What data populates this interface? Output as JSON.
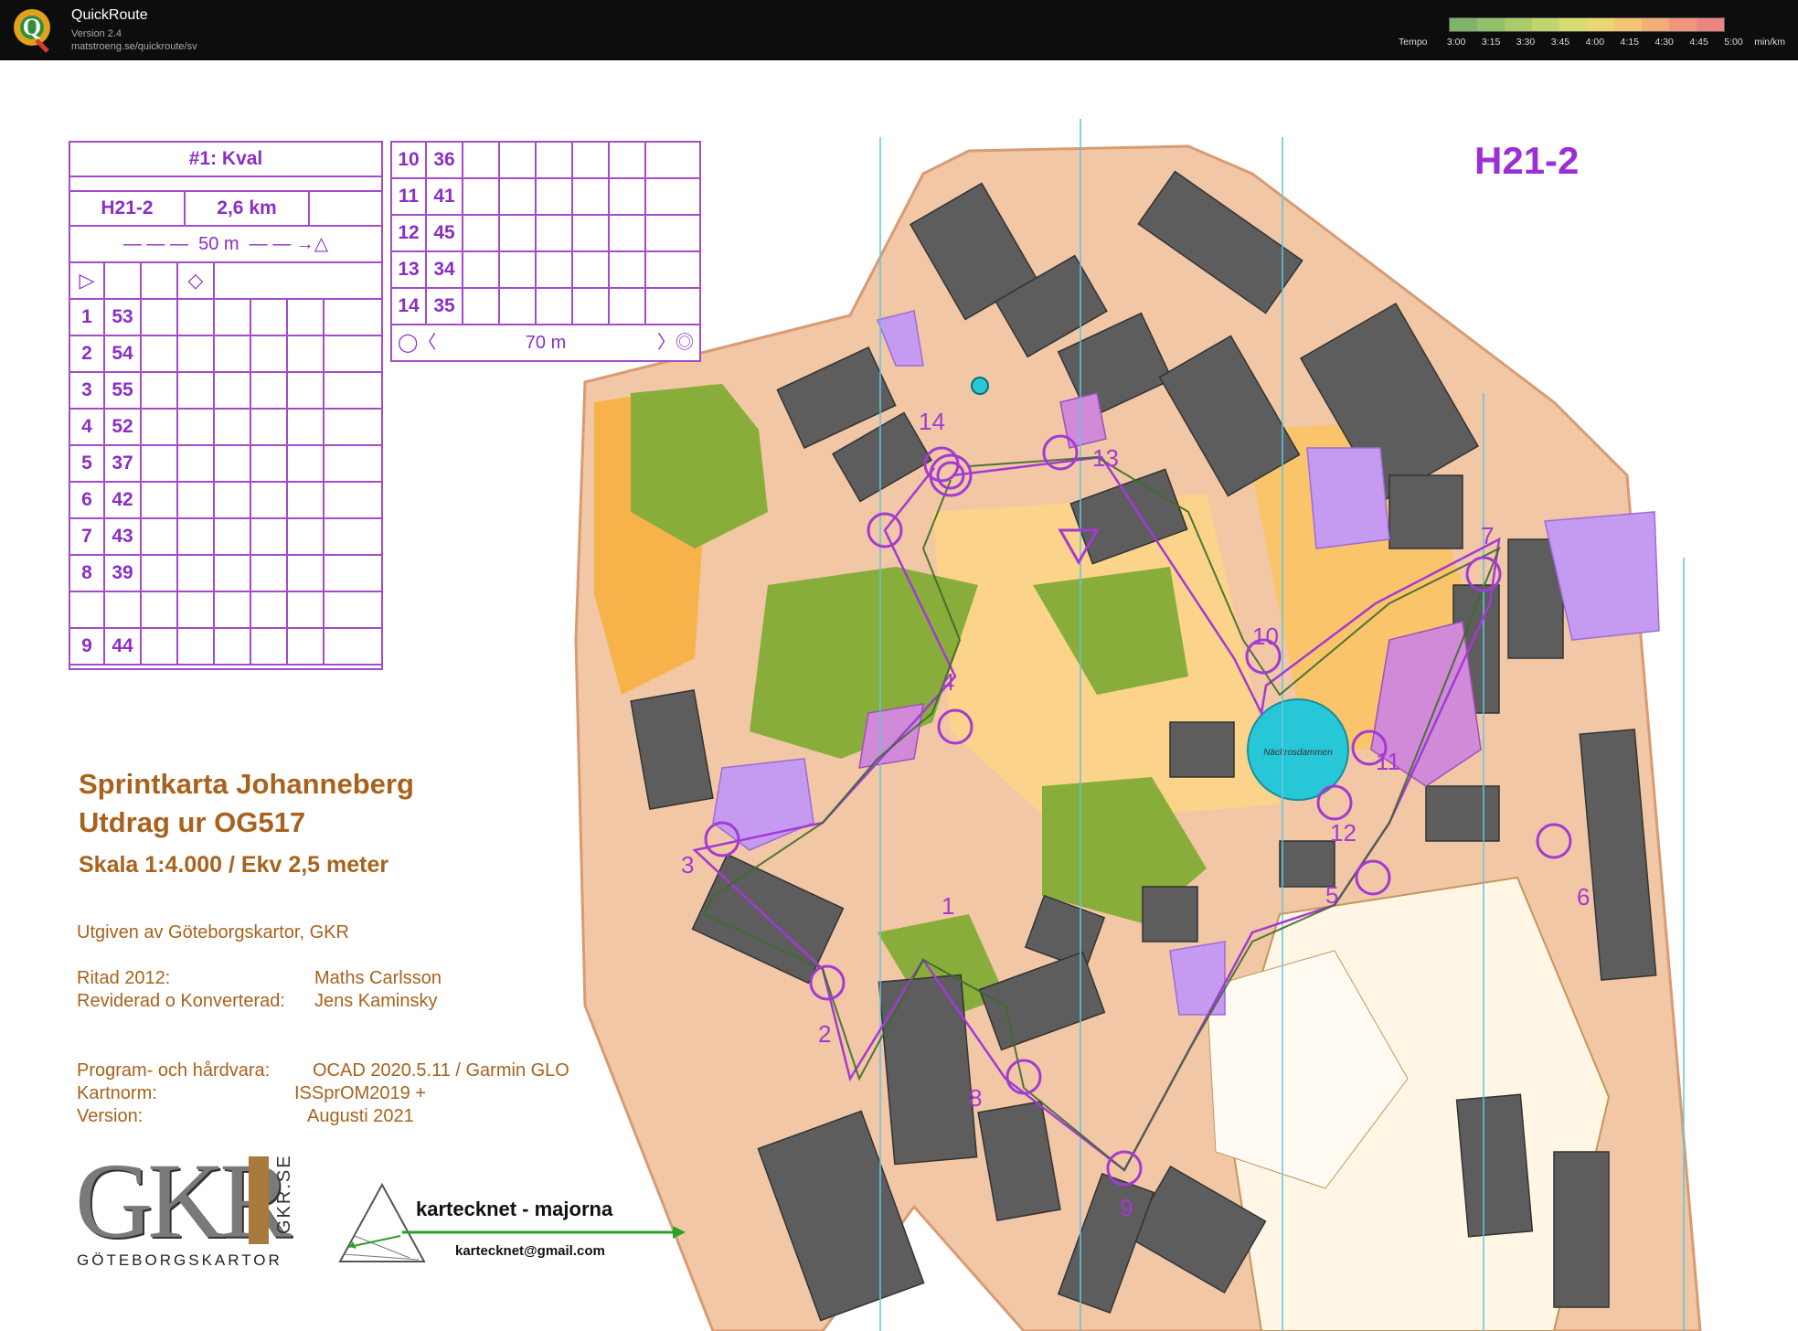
{
  "app": {
    "title": "QuickRoute",
    "version": "Version 2.4",
    "url": "matstroeng.se/quickroute/sv",
    "tempo_label": "Tempo",
    "tempo_ticks": [
      "3:00",
      "3:15",
      "3:30",
      "3:45",
      "4:00",
      "4:15",
      "4:30",
      "4:45",
      "5:00"
    ],
    "tempo_unit": "min/km",
    "tempo_colors": [
      "#7fb36a",
      "#93c06b",
      "#a9cb6c",
      "#c0d56e",
      "#d7dc70",
      "#e9d772",
      "#f2c474",
      "#f3ae78",
      "#f0977b",
      "#ec8480"
    ]
  },
  "map": {
    "course_label": "H21-2",
    "title_line1": "Sprintkarta Johanneberg",
    "title_line2": "Utdrag ur OG517",
    "scale_line": "Skala 1:4.000 / Ekv 2,5 meter",
    "publisher": "Utgiven av Göteborgskartor, GKR",
    "drawn_label": "Ritad 2012:",
    "drawn_by": "Maths Carlsson",
    "revised_label": "Reviderad o Konverterad:",
    "revised_by": "Jens Kaminsky",
    "software_label": "Program- och hårdvara:",
    "software": "OCAD 2020.5.11 / Garmin GLO",
    "norm_label": "Kartnorm:",
    "norm": "ISSprOM2019 +",
    "version_label": "Version:",
    "version": "Augusti 2021",
    "gkr_logo": "GKR",
    "gkr_side": "GKR.SE",
    "gkr_sub": "GÖTEBORGSKARTOR",
    "sponsor_name": "kartecknet - majorna",
    "sponsor_email": "kartecknet@gmail.com",
    "pond_name": "Näckrosdammen",
    "control_numbers": [
      "1",
      "2",
      "3",
      "4",
      "5",
      "6",
      "7",
      "8",
      "9",
      "10",
      "11",
      "12",
      "13",
      "14"
    ]
  },
  "control_descriptions": {
    "event": "#1: Kval",
    "class": "H21-2",
    "length": "2,6 km",
    "start_marking": "50 m",
    "finish_marking": "70 m",
    "rows": [
      {
        "n": "1",
        "code": "53"
      },
      {
        "n": "2",
        "code": "54"
      },
      {
        "n": "3",
        "code": "55"
      },
      {
        "n": "4",
        "code": "52"
      },
      {
        "n": "5",
        "code": "37"
      },
      {
        "n": "6",
        "code": "42"
      },
      {
        "n": "7",
        "code": "43"
      },
      {
        "n": "8",
        "code": "39"
      },
      {
        "n": "",
        "code": ""
      },
      {
        "n": "9",
        "code": "44"
      },
      {
        "n": "10",
        "code": "36"
      },
      {
        "n": "11",
        "code": "41"
      },
      {
        "n": "12",
        "code": "45"
      },
      {
        "n": "13",
        "code": "34"
      },
      {
        "n": "14",
        "code": "35"
      }
    ]
  }
}
